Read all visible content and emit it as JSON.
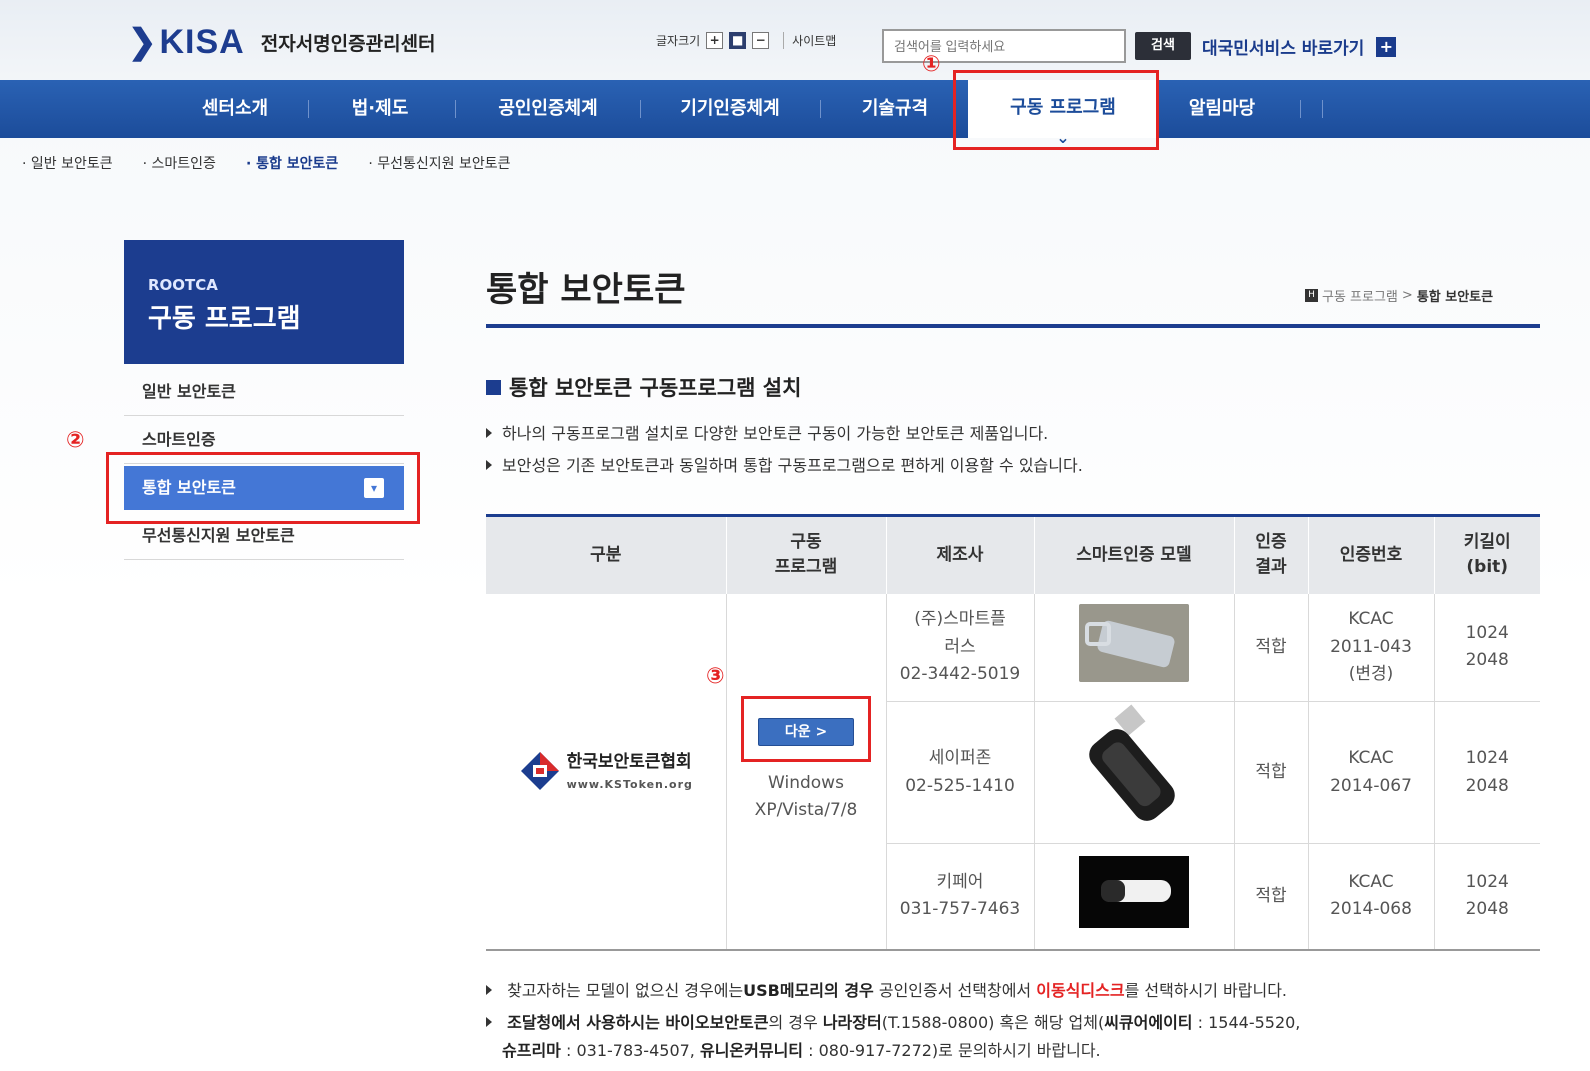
{
  "header": {
    "logo_text": "KISA",
    "center_name": "전자서명인증관리센터",
    "font_size_label": "글자크기",
    "font_plus": "+",
    "font_reset": "■",
    "font_minus": "−",
    "sitemap": "사이트맵",
    "search_placeholder": "검색어를 입력하세요",
    "search_button": "검색",
    "gov_service": "대국민서비스 바로가기",
    "gov_plus": "+"
  },
  "gnb": [
    "센터소개",
    "법·제도",
    "공인인증체계",
    "기기인증체계",
    "기술규격",
    "구동 프로그램",
    "알림마당"
  ],
  "subnav": [
    "· 일반 보안토큰",
    "· 스마트인증",
    "· 통합 보안토큰",
    "· 무선통신지원 보안토큰"
  ],
  "lnb": {
    "head_small": "ROOTCA",
    "head_title": "구동 프로그램",
    "items": [
      "일반 보안토큰",
      "스마트인증",
      "통합 보안토큰",
      "무선통신지원 보안토큰"
    ]
  },
  "annotations": [
    "①",
    "②",
    "③"
  ],
  "content": {
    "page_title": "통합 보안토큰",
    "breadcrumb_icon": "H",
    "breadcrumb_parent": "구동 프로그램",
    "breadcrumb_sep": ">",
    "breadcrumb_current": "통합 보안토큰",
    "section_title": "통합 보안토큰 구동프로그램 설치",
    "bullet1": "하나의 구동프로그램 설치로 다양한 보안토큰 구동이 가능한 보안토큰 제품입니다.",
    "bullet2": "보안성은 기존 보안토큰과 동일하며 통합 구동프로그램으로 편하게 이용할 수 있습니다."
  },
  "table": {
    "headers": [
      "구분",
      "구동\n프로그램",
      "제조사",
      "스마트인증 모델",
      "인증\n결과",
      "인증번호",
      "키길이\n(bit)"
    ],
    "association_name": "한국보안토큰협회",
    "association_url": "www.KSToken.org",
    "download_label": "다운 >",
    "os_support": "Windows\nXP/Vista/7/8",
    "rows": [
      {
        "maker": "(주)스마트플\n러스\n02-3442-5019",
        "result": "적합",
        "cert": "KCAC\n2011-043\n(변경)",
        "key": "1024\n2048"
      },
      {
        "maker": "세이퍼존\n02-525-1410",
        "result": "적합",
        "cert": "KCAC\n2014-067",
        "key": "1024\n2048"
      },
      {
        "maker": "키페어\n031-757-7463",
        "result": "적합",
        "cert": "KCAC\n2014-068",
        "key": "1024\n2048"
      }
    ]
  },
  "notes": {
    "n1_a": "찾고자하는 모델이 없으신 경우에는",
    "n1_b": "USB메모리의 경우",
    "n1_c": " 공인인증서 선택창에서 ",
    "n1_d": "이동식디스크",
    "n1_e": "를 선택하시기 바랍니다.",
    "n2_a": "조달청에서 사용하시는 바이오보안토큰",
    "n2_b": "의 경우 ",
    "n2_c": "나라장터",
    "n2_d": "(T.1588-0800) 혹은 해당 업체(",
    "n2_e": "씨큐어에이티",
    "n2_f": " : 1544-5520,",
    "n3_a": "슈프리마",
    "n3_b": " : 031-783-4507, ",
    "n3_c": "유니온커뮤니티",
    "n3_d": " : 080-917-7272)로 문의하시기 바랍니다."
  },
  "colors": {
    "navy": "#1c3d8f",
    "gnb_blue": "#1c4c9a",
    "accent_red": "#e42323",
    "lnb_active": "#4477d6"
  }
}
